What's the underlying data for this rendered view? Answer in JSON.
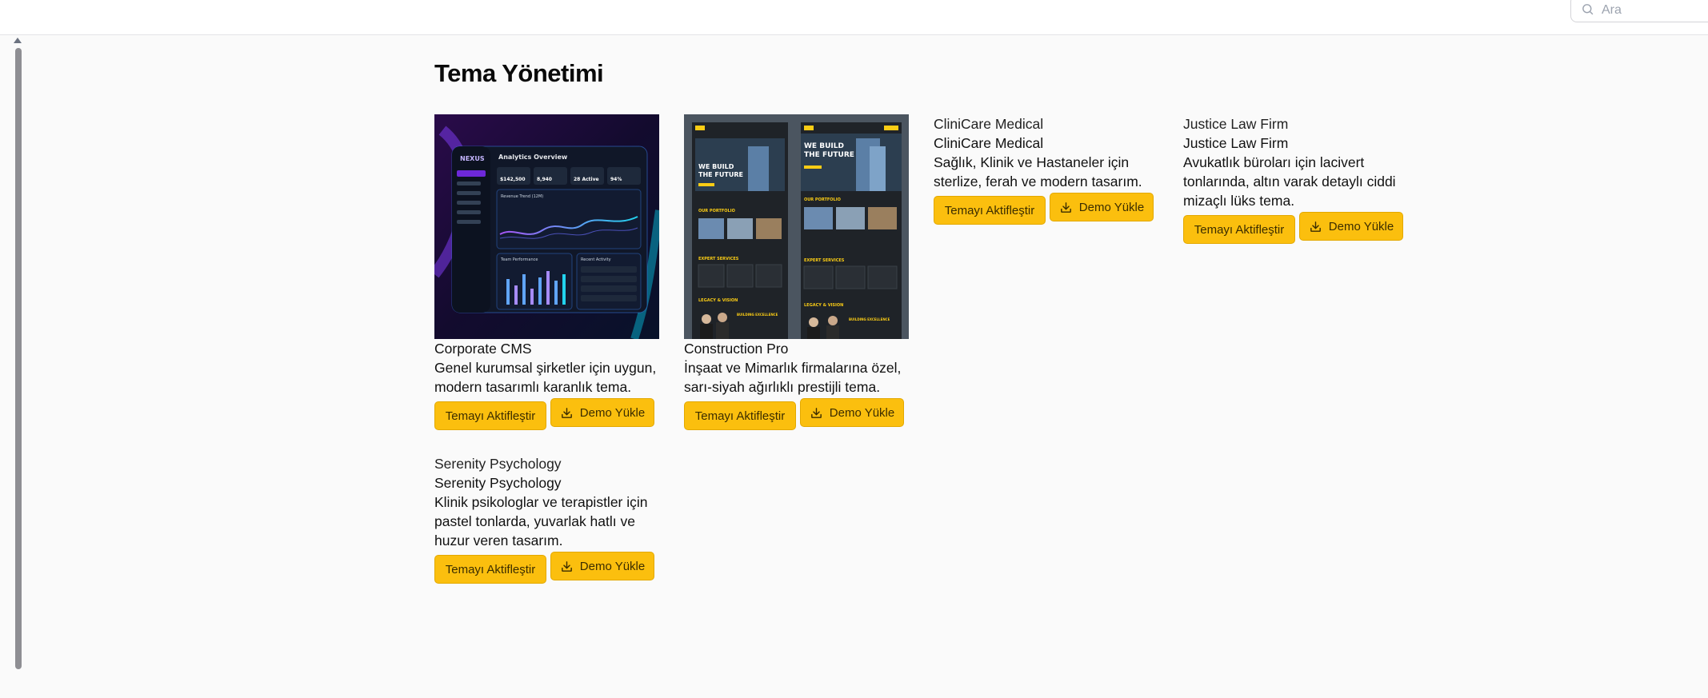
{
  "header": {
    "search_placeholder": "Ara"
  },
  "page": {
    "title": "Tema Yönetimi"
  },
  "themes": [
    {
      "image_alt": "",
      "name": "Corporate CMS",
      "desc_line1": "Genel kurumsal şirketler için uygun,",
      "desc_line2": "modern tasarımlı karanlık tema.",
      "desc_line3": "",
      "activate_label": "Temayı Aktifleştir",
      "demo_label": "Demo Yükle",
      "preview": {
        "brand": "NEXUS",
        "heading": "Analytics Overview",
        "stat1": "$142,500",
        "stat2": "8,940",
        "stat3": "28 Active",
        "stat4": "94%",
        "chart_label": "Revenue Trend (12M)",
        "bar_label": "Team Performance",
        "activity_label": "Recent Activity"
      }
    },
    {
      "image_alt": "",
      "name": "Construction Pro",
      "desc_line1": "İnşaat ve Mimarlık firmalarına özel,",
      "desc_line2": "sarı-siyah ağırlıklı prestijli tema.",
      "desc_line3": "",
      "activate_label": "Temayı Aktifleştir",
      "demo_label": "Demo Yükle",
      "preview": {
        "hero1": "WE BUILD",
        "hero2": "THE FUTURE",
        "portfolio": "OUR PORTFOLIO",
        "services": "EXPERT SERVICES",
        "legacy": "LEGACY & VISION",
        "excellence": "BUILDING EXCELLENCE"
      }
    },
    {
      "image_alt": "CliniCare Medical",
      "name": "CliniCare Medical",
      "desc_line1": "Sağlık, Klinik ve Hastaneler için",
      "desc_line2": "sterlize, ferah ve modern tasarım.",
      "desc_line3": "",
      "activate_label": "Temayı Aktifleştir",
      "demo_label": "Demo Yükle"
    },
    {
      "image_alt": "Justice Law Firm",
      "name": "Justice Law Firm",
      "desc_line1": "Avukatlık büroları için lacivert",
      "desc_line2": "tonlarında, altın varak detaylı ciddi",
      "desc_line3": "mizaçlı lüks tema.",
      "activate_label": "Temayı Aktifleştir",
      "demo_label": "Demo Yükle"
    },
    {
      "image_alt": "Serenity Psychology",
      "name": "Serenity Psychology",
      "desc_line1": "Klinik psikologlar ve terapistler için",
      "desc_line2": "pastel tonlarda, yuvarlak hatlı ve",
      "desc_line3": "huzur veren tasarım.",
      "activate_label": "Temayı Aktifleştir",
      "demo_label": "Demo Yükle"
    }
  ],
  "colors": {
    "accent": "#fbbf0e",
    "accent_border": "#e3a800"
  }
}
